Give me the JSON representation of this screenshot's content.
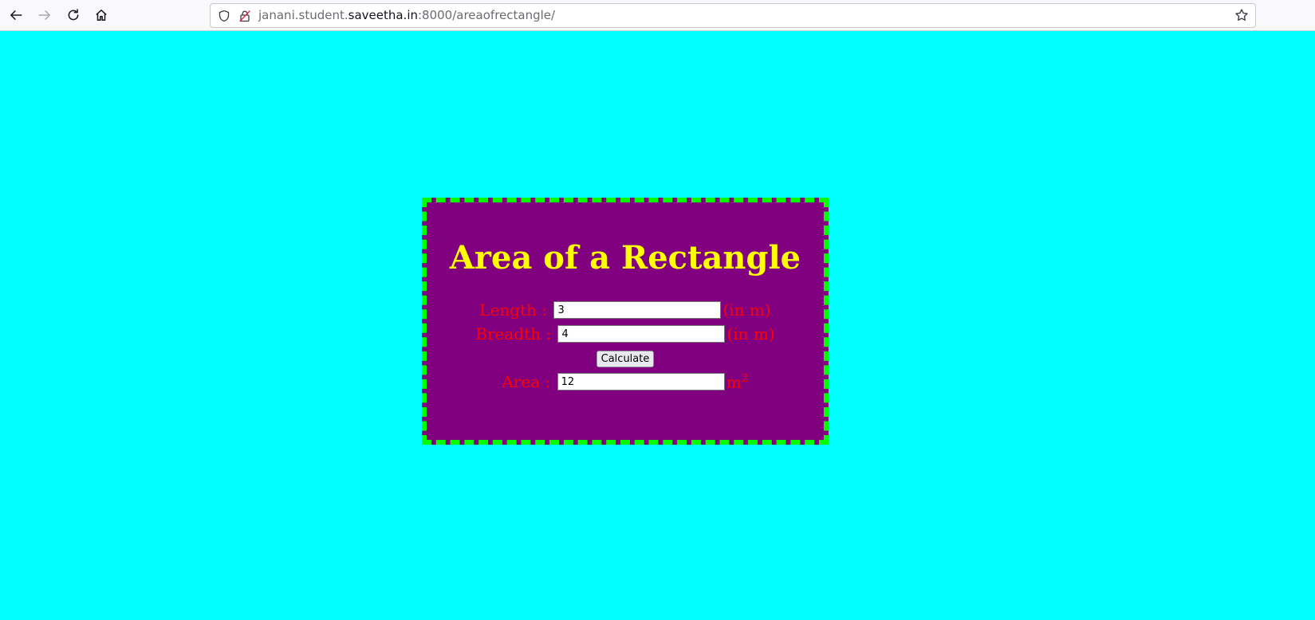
{
  "browser": {
    "url_prefix": "janani.student.",
    "url_host": "saveetha.in",
    "url_suffix": ":8000/areaofrectangle/"
  },
  "page": {
    "title": "Area of a Rectangle",
    "length_label": "Length :",
    "length_value": "3",
    "length_unit": "(in m)",
    "breadth_label": "Breadth :",
    "breadth_value": "4",
    "breadth_unit": "(in m)",
    "calculate_label": "Calculate",
    "area_label": "Area :",
    "area_value": "12",
    "area_unit": "m",
    "area_unit_exponent": "2"
  },
  "colors": {
    "background": "#00ffff",
    "card": "#800080",
    "border": "#00ff00",
    "title": "#ffff00",
    "labels": "#ff0000"
  },
  "icons": {
    "back": "back-arrow-icon",
    "forward": "forward-arrow-icon",
    "reload": "reload-icon",
    "home": "home-icon",
    "shield": "shield-icon",
    "insecure": "insecure-lock-icon",
    "bookmark": "star-icon"
  }
}
